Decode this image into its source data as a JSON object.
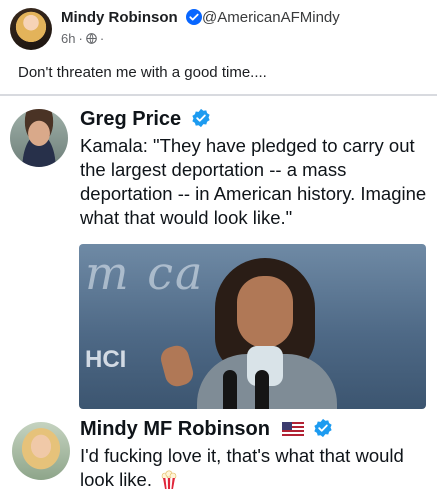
{
  "outer_post": {
    "author_name": "Mindy Robinson",
    "handle": "@AmericanAFMindy",
    "time": "6h",
    "separator": "·",
    "text": "Don't threaten me with a good time...."
  },
  "quoted_tweet": {
    "author_name": "Greg Price",
    "text": "Kamala: \"They have pledged to carry out the largest deportation -- a mass deportation -- in American history. Imagine what that would look like.\""
  },
  "media": {
    "backdrop_text": "HCI"
  },
  "reply_tweet": {
    "author_name": "Mindy MF Robinson",
    "text": "I'd fucking love it, that's what that would look like."
  },
  "colors": {
    "verified_blue": "#1d9bf0",
    "facebook_verified": "#0866ff"
  },
  "icons": {
    "verified": "verified-badge-icon",
    "audience": "globe-icon",
    "flag": "us-flag-icon",
    "popcorn": "popcorn-icon"
  }
}
